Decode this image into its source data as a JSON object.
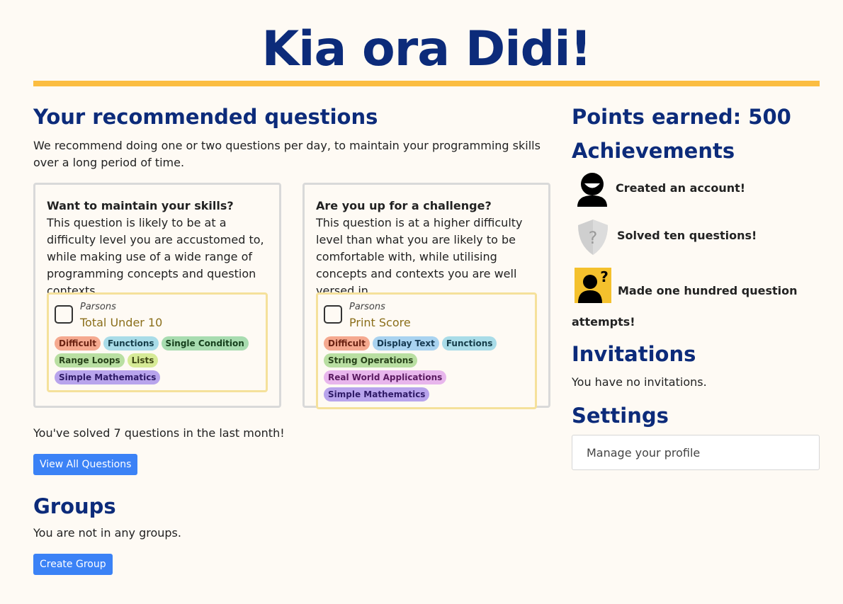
{
  "greeting": "Kia ora Didi!",
  "recommended": {
    "heading": "Your recommended questions",
    "intro": "We recommend doing one or two questions per day, to maintain your programming skills over a long period of time.",
    "cards": [
      {
        "title": "Want to maintain your skills?",
        "description": "This question is likely to be at a difficulty level you are accustomed to, while making use of a wide range of programming concepts and question contexts.",
        "question": {
          "type": "Parsons",
          "name": "Total Under 10",
          "tags": [
            {
              "label": "Difficult",
              "color": "#f5a98f"
            },
            {
              "label": "Functions",
              "color": "#a9dce8"
            },
            {
              "label": "Single Condition",
              "color": "#a8dcb0"
            },
            {
              "label": "Range Loops",
              "color": "#b9dfa2"
            },
            {
              "label": "Lists",
              "color": "#d6ea96"
            },
            {
              "label": "Simple Mathematics",
              "color": "#b8a4ec"
            }
          ]
        }
      },
      {
        "title": "Are you up for a challenge?",
        "description": "This question is at a higher difficulty level than what you are likely to be comfortable with, while utilising concepts and contexts you are well versed in.",
        "question": {
          "type": "Parsons",
          "name": "Print Score",
          "tags": [
            {
              "label": "Difficult",
              "color": "#f5a98f"
            },
            {
              "label": "Display Text",
              "color": "#a9d3f0"
            },
            {
              "label": "Functions",
              "color": "#a9dce8"
            },
            {
              "label": "String Operations",
              "color": "#b9dfa2"
            },
            {
              "label": "Real World Applications",
              "color": "#e8b6ec"
            },
            {
              "label": "Simple Mathematics",
              "color": "#b8a4ec"
            }
          ]
        }
      }
    ],
    "solved_text": "You've solved 7 questions in the last month!",
    "view_all_label": "View All Questions"
  },
  "groups": {
    "heading": "Groups",
    "empty_text": "You are not in any groups.",
    "create_label": "Create Group"
  },
  "points": {
    "heading": "Points earned: 500"
  },
  "achievements": {
    "heading": "Achievements",
    "items": [
      {
        "label": "Created an account!",
        "icon": "account-created-icon"
      },
      {
        "label": "Solved ten questions!",
        "icon": "locked-shield-icon"
      },
      {
        "label": "Made one hundred question attempts!",
        "icon": "mystery-person-icon"
      }
    ]
  },
  "invitations": {
    "heading": "Invitations",
    "empty_text": "You have no invitations."
  },
  "settings": {
    "heading": "Settings",
    "manage_profile_label": "Manage your profile"
  }
}
